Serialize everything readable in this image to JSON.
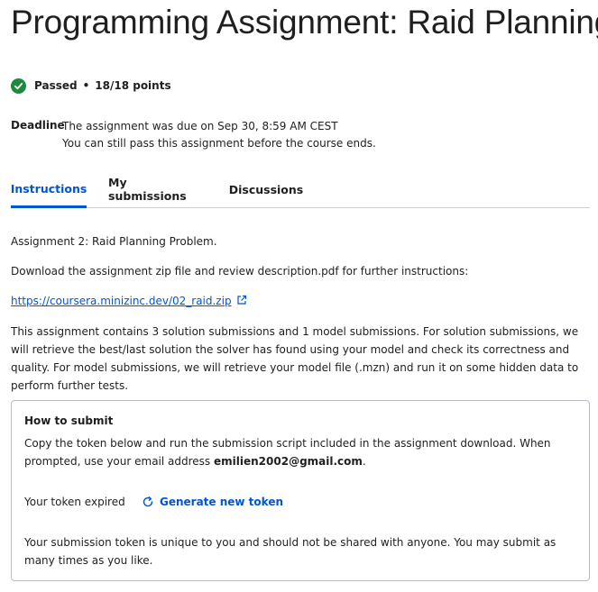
{
  "page": {
    "title": "Programming Assignment: Raid Planning"
  },
  "status": {
    "passed_label": "Passed",
    "separator": "•",
    "points": "18/18 points",
    "accent_color": "#1e8a3e"
  },
  "deadline": {
    "label": "Deadline",
    "line1": "The assignment was due on Sep 30, 8:59 AM CEST",
    "line2": "You can still pass this assignment before the course ends."
  },
  "tabs": [
    {
      "label": "Instructions",
      "active": true
    },
    {
      "label": "My submissions",
      "active": false
    },
    {
      "label": "Discussions",
      "active": false
    }
  ],
  "instructions": {
    "p1": "Assignment 2: Raid Planning Problem.",
    "p2": "Download the assignment zip file and review description.pdf for further instructions:",
    "link": "https://coursera.minizinc.dev/02_raid.zip",
    "p4": "This assignment contains 3 solution submissions and 1 model submissions. For solution submissions, we will retrieve the best/last solution the solver has found using your model and check its correctness and quality. For model submissions, we will retrieve your model file (.mzn) and run it on some hidden data to perform further tests."
  },
  "submit": {
    "heading": "How to submit",
    "text_before_email": "Copy the token below and run the submission script included in the assignment download. When prompted, use your email address ",
    "email": "emilien2002@gmail.com",
    "text_after_email": ".",
    "token_status": "Your token expired",
    "generate_label": "Generate new token",
    "note": "Your submission token is unique to you and should not be shared with anyone. You may submit as many times as you like."
  },
  "colors": {
    "link": "#0056d2",
    "text": "#1f1f1f"
  }
}
